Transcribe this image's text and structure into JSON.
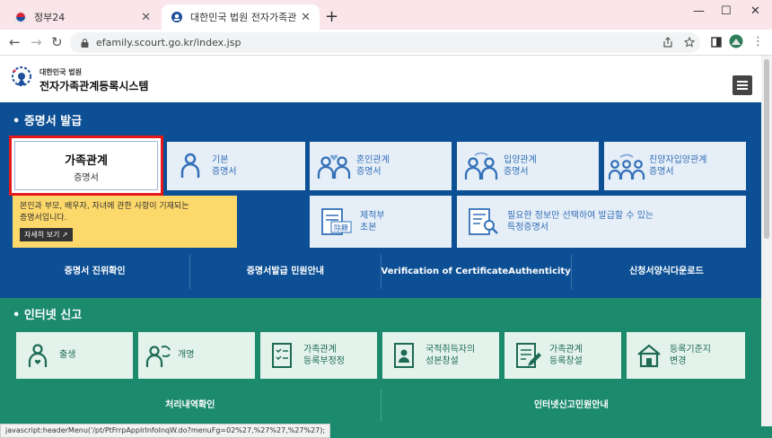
{
  "browser": {
    "tabs": [
      {
        "title": "정부24",
        "close": "✕"
      },
      {
        "title": "대한민국 법원 전자가족관계등록",
        "close": "✕"
      }
    ],
    "new_tab": "+",
    "window": {
      "minimize": "—",
      "maximize": "☐",
      "close": "✕"
    },
    "nav": {
      "back": "←",
      "forward": "→",
      "reload": "↻"
    },
    "url": "efamily.scourt.go.kr/index.jsp",
    "status_url": "javascript:headerMenu('/pt/PtFrrpApplrInfoInqW.do?menuFg=02%27,%27%27,%27%27);"
  },
  "site": {
    "logo_sub": "대한민국 법원",
    "logo_main": "전자가족관계등록시스템"
  },
  "cert": {
    "title": "• 증명서 발급",
    "selected": {
      "line1": "가족관계",
      "line2": "증명서"
    },
    "cards": [
      {
        "line1": "기본",
        "line2": "증명서"
      },
      {
        "line1": "혼인관계",
        "line2": "증명서"
      },
      {
        "line1": "입양관계",
        "line2": "증명서"
      },
      {
        "line1": "친양자입양관계",
        "line2": "증명서"
      },
      {
        "line1": "제적부",
        "line2": "초본"
      },
      {
        "line1": "필요한 정보만 선택하여 발급할 수 있는",
        "line2": "특정증명서"
      }
    ],
    "info": {
      "line1": "본인과 부모, 배우자, 자녀에 관한 사항이 기재되는",
      "line2": "증명서입니다.",
      "more": "자세히 보기 ↗"
    },
    "seal_text": "除籍",
    "links": [
      "증명서 진위확인",
      "증명서발급 민원안내",
      "Verification of CertificateAuthenticity",
      "신청서양식다운로드"
    ]
  },
  "inet": {
    "title": "• 인터넷 신고",
    "cards": [
      {
        "line1": "출생",
        "line2": ""
      },
      {
        "line1": "개명",
        "line2": ""
      },
      {
        "line1": "가족관계",
        "line2": "등록부정정"
      },
      {
        "line1": "국적취득자의",
        "line2": "성본창설"
      },
      {
        "line1": "가족관계",
        "line2": "등록창설"
      },
      {
        "line1": "등록기준지",
        "line2": "변경"
      }
    ],
    "links": [
      "처리내역확인",
      "인터넷신고민원안내"
    ]
  },
  "colors": {
    "cert_bg": "#0c4f94",
    "inet_bg": "#1b8a6d",
    "highlight": "#e21a1a",
    "info_bg": "#fdd86a"
  }
}
